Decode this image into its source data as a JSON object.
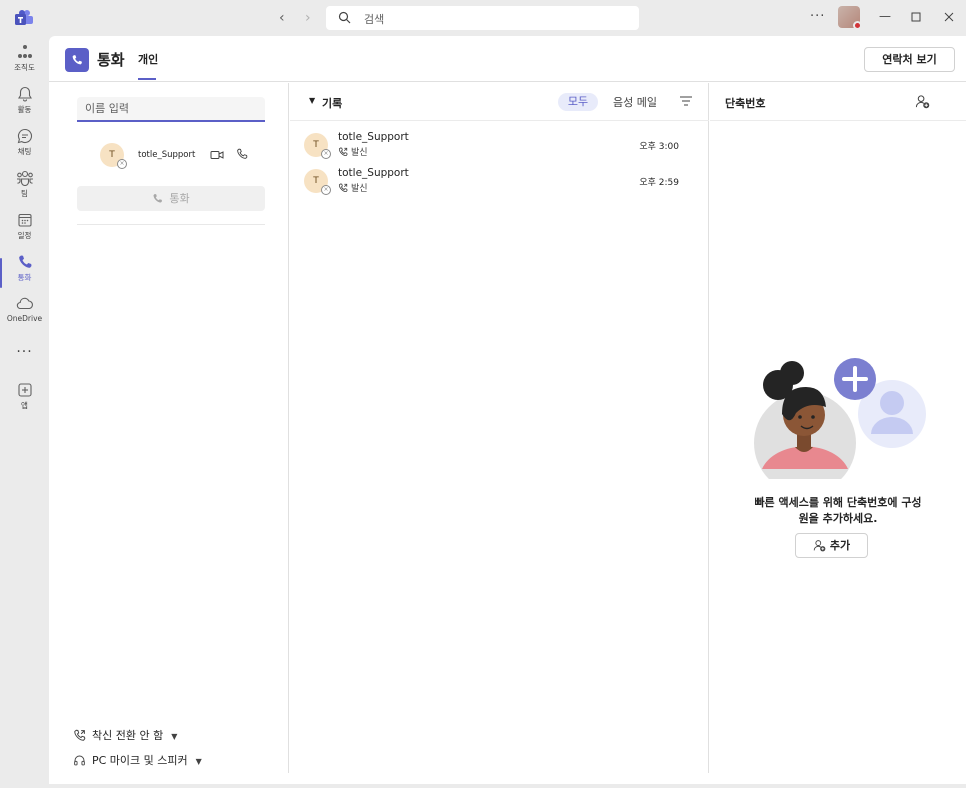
{
  "titlebar": {
    "search_placeholder": "검색",
    "more": "···"
  },
  "rail": {
    "items": [
      {
        "label": "조직도",
        "icon": "org-chart-icon"
      },
      {
        "label": "활동",
        "icon": "bell-icon"
      },
      {
        "label": "채팅",
        "icon": "chat-icon"
      },
      {
        "label": "팀",
        "icon": "teams-icon"
      },
      {
        "label": "일정",
        "icon": "calendar-icon"
      },
      {
        "label": "통화",
        "icon": "phone-icon",
        "active": true
      },
      {
        "label": "OneDrive",
        "icon": "cloud-icon"
      },
      {
        "label": "앱",
        "icon": "add-app-icon"
      }
    ],
    "more": "···"
  },
  "header": {
    "title": "통화",
    "tab_personal": "개인",
    "contacts_button": "연락처 보기"
  },
  "dial": {
    "name_placeholder": "이름 입력",
    "suggestion_initial": "T",
    "suggestion_name": "totle_Support",
    "call_button": "통화",
    "call_forward": "착신 전환 안 함",
    "audio_device": "PC 마이크 및 스피커"
  },
  "history": {
    "title": "기록",
    "filter_all": "모두",
    "filter_voicemail": "음성 메일",
    "entries": [
      {
        "initial": "T",
        "name": "totle_Support",
        "direction": "발신",
        "time": "오후 3:00"
      },
      {
        "initial": "T",
        "name": "totle_Support",
        "direction": "발신",
        "time": "오후 2:59"
      }
    ]
  },
  "speed_dial": {
    "title": "단축번호",
    "message_line1": "빠른 액세스를 위해 단축번호에 구성",
    "message_line2": "원을 추가하세요.",
    "add_button": "추가"
  },
  "colors": {
    "accent": "#5b5fc7",
    "rail_bg": "#ebebeb",
    "avatar_bg": "#f7e2c3"
  }
}
